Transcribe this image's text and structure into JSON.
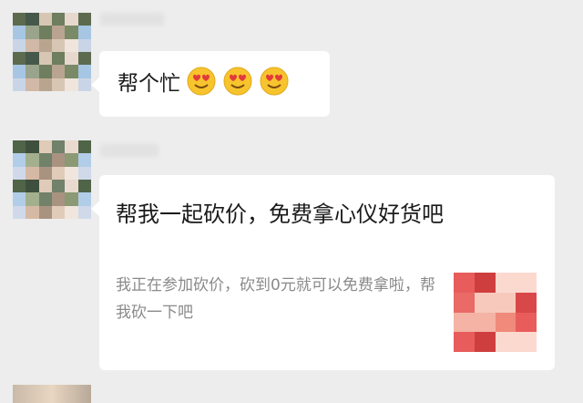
{
  "messages": [
    {
      "type": "text",
      "text": "帮个忙",
      "emojis": [
        "heart-eyes-emoji",
        "heart-eyes-emoji",
        "heart-eyes-emoji"
      ]
    },
    {
      "type": "link-card",
      "title": "帮我一起砍价，免费拿心仪好货吧",
      "description": "我正在参加砍价，砍到0元就可以免费拿啦，帮我砍一下吧"
    }
  ],
  "colors": {
    "background": "#ededed",
    "bubble": "#ffffff",
    "primary_text": "#1a1a1a",
    "secondary_text": "#8a8a8a",
    "emoji_face": "#f7c42d",
    "emoji_heart": "#e23b3b"
  }
}
